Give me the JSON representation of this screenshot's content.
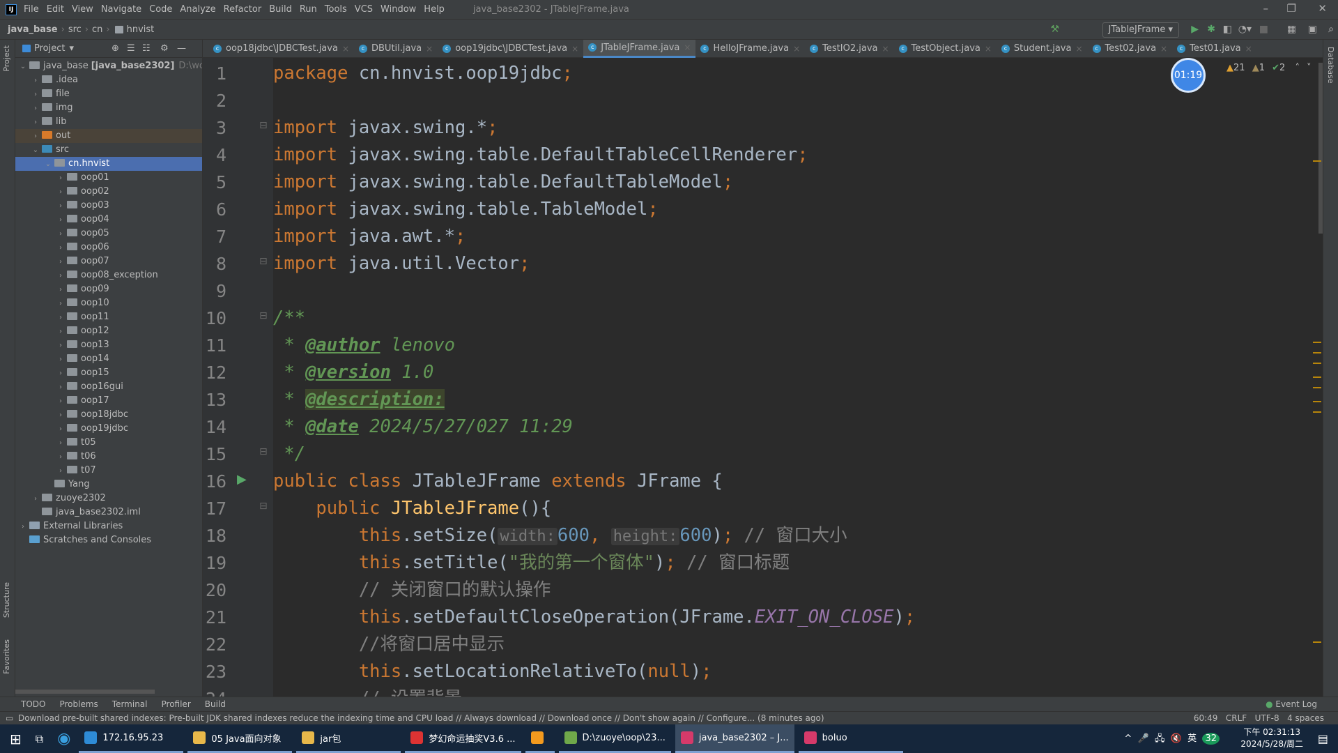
{
  "menubar": {
    "items": [
      "File",
      "Edit",
      "View",
      "Navigate",
      "Code",
      "Analyze",
      "Refactor",
      "Build",
      "Run",
      "Tools",
      "VCS",
      "Window",
      "Help"
    ],
    "window_title": "java_base2302 - JTableJFrame.java"
  },
  "breadcrumb": [
    "java_base",
    "src",
    "cn",
    "hnvist"
  ],
  "toolbar": {
    "run_config": "JTableJFrame"
  },
  "project": {
    "title": "Project",
    "tree": [
      {
        "d": 0,
        "label": "java_base",
        "bold": "[java_base2302]",
        "path": "D:\\work\\gg",
        "exp": true,
        "t": "mod"
      },
      {
        "d": 1,
        "label": ".idea",
        "t": "dir"
      },
      {
        "d": 1,
        "label": "file",
        "t": "dir"
      },
      {
        "d": 1,
        "label": "img",
        "t": "dir"
      },
      {
        "d": 1,
        "label": "lib",
        "t": "dir"
      },
      {
        "d": 1,
        "label": "out",
        "t": "out"
      },
      {
        "d": 1,
        "label": "src",
        "t": "src",
        "exp": true
      },
      {
        "d": 2,
        "label": "cn.hnvist",
        "t": "pkg",
        "exp": true,
        "sel": true
      },
      {
        "d": 3,
        "label": "oop01",
        "t": "pkg"
      },
      {
        "d": 3,
        "label": "oop02",
        "t": "pkg"
      },
      {
        "d": 3,
        "label": "oop03",
        "t": "pkg"
      },
      {
        "d": 3,
        "label": "oop04",
        "t": "pkg"
      },
      {
        "d": 3,
        "label": "oop05",
        "t": "pkg"
      },
      {
        "d": 3,
        "label": "oop06",
        "t": "pkg"
      },
      {
        "d": 3,
        "label": "oop07",
        "t": "pkg"
      },
      {
        "d": 3,
        "label": "oop08_exception",
        "t": "pkg"
      },
      {
        "d": 3,
        "label": "oop09",
        "t": "pkg"
      },
      {
        "d": 3,
        "label": "oop10",
        "t": "pkg"
      },
      {
        "d": 3,
        "label": "oop11",
        "t": "pkg"
      },
      {
        "d": 3,
        "label": "oop12",
        "t": "pkg"
      },
      {
        "d": 3,
        "label": "oop13",
        "t": "pkg"
      },
      {
        "d": 3,
        "label": "oop14",
        "t": "pkg"
      },
      {
        "d": 3,
        "label": "oop15",
        "t": "pkg"
      },
      {
        "d": 3,
        "label": "oop16gui",
        "t": "pkg"
      },
      {
        "d": 3,
        "label": "oop17",
        "t": "pkg"
      },
      {
        "d": 3,
        "label": "oop18jdbc",
        "t": "pkg"
      },
      {
        "d": 3,
        "label": "oop19jdbc",
        "t": "pkg"
      },
      {
        "d": 3,
        "label": "t05",
        "t": "pkg"
      },
      {
        "d": 3,
        "label": "t06",
        "t": "pkg"
      },
      {
        "d": 3,
        "label": "t07",
        "t": "pkg"
      },
      {
        "d": 2,
        "label": "Yang",
        "t": "pkg",
        "leaf": true
      },
      {
        "d": 1,
        "label": "zuoye2302",
        "t": "pkg"
      },
      {
        "d": 1,
        "label": "java_base2302.iml",
        "t": "file",
        "leaf": true
      },
      {
        "d": 0,
        "label": "External Libraries",
        "t": "lib"
      },
      {
        "d": 0,
        "label": "Scratches and Consoles",
        "t": "scratch",
        "leaf": true
      }
    ]
  },
  "tabs": [
    {
      "label": "oop18jdbc\\JDBCTest.java"
    },
    {
      "label": "DBUtil.java"
    },
    {
      "label": "oop19jdbc\\JDBCTest.java"
    },
    {
      "label": "JTableJFrame.java",
      "active": true
    },
    {
      "label": "HelloJFrame.java"
    },
    {
      "label": "TestIO2.java"
    },
    {
      "label": "TestObject.java"
    },
    {
      "label": "Student.java"
    },
    {
      "label": "Test02.java"
    },
    {
      "label": "Test01.java"
    }
  ],
  "timer": "01:19",
  "inspections": {
    "warnings": "21",
    "weak_warnings": "1",
    "ok": "2"
  },
  "code": [
    [
      [
        "k",
        "package "
      ],
      [
        "",
        "cn.hnvist.oop19jdbc"
      ],
      [
        "k",
        ";"
      ]
    ],
    [],
    [
      [
        "k",
        "import "
      ],
      [
        "",
        "javax.swing.*"
      ],
      [
        "k",
        ";"
      ]
    ],
    [
      [
        "k",
        "import "
      ],
      [
        "",
        "javax.swing.table.DefaultTableCellRenderer"
      ],
      [
        "k",
        ";"
      ]
    ],
    [
      [
        "k",
        "import "
      ],
      [
        "",
        "javax.swing.table.DefaultTableModel"
      ],
      [
        "k",
        ";"
      ]
    ],
    [
      [
        "k",
        "import "
      ],
      [
        "",
        "javax.swing.table.TableModel"
      ],
      [
        "k",
        ";"
      ]
    ],
    [
      [
        "k",
        "import "
      ],
      [
        "",
        "java.awt.*"
      ],
      [
        "k",
        ";"
      ]
    ],
    [
      [
        "k",
        "import "
      ],
      [
        "",
        "java.util.Vector"
      ],
      [
        "k",
        ";"
      ]
    ],
    [],
    [
      [
        "j",
        "/**"
      ]
    ],
    [
      [
        "j",
        " * "
      ],
      [
        "jt",
        "@author"
      ],
      [
        "j",
        " lenovo"
      ]
    ],
    [
      [
        "j",
        " * "
      ],
      [
        "jt",
        "@version"
      ],
      [
        "j",
        " 1.0"
      ]
    ],
    [
      [
        "j",
        " * "
      ],
      [
        "jt jh",
        "@description:"
      ]
    ],
    [
      [
        "j",
        " * "
      ],
      [
        "jt",
        "@date"
      ],
      [
        "j",
        " 2024/5/27/027 11:29"
      ]
    ],
    [
      [
        "j",
        " */"
      ]
    ],
    [
      [
        "k",
        "public class "
      ],
      [
        "",
        "JTableJFrame "
      ],
      [
        "k",
        "extends "
      ],
      [
        "",
        "JFrame {"
      ]
    ],
    [
      [
        "",
        "    "
      ],
      [
        "k",
        "public "
      ],
      [
        "m",
        "JTableJFrame"
      ],
      [
        "",
        "(){"
      ]
    ],
    [
      [
        "",
        "        "
      ],
      [
        "k",
        "this"
      ],
      [
        "",
        ".setSize("
      ],
      [
        "h",
        "width:"
      ],
      [
        "n",
        "600"
      ],
      [
        "k",
        ", "
      ],
      [
        "h",
        "height:"
      ],
      [
        "n",
        "600"
      ],
      [
        "",
        ")"
      ],
      [
        "k",
        ";"
      ],
      [
        "c",
        " // 窗口大小"
      ]
    ],
    [
      [
        "",
        "        "
      ],
      [
        "k",
        "this"
      ],
      [
        "",
        ".setTitle("
      ],
      [
        "s",
        "\"我的第一个窗体\""
      ],
      [
        "",
        ")"
      ],
      [
        "k",
        ";"
      ],
      [
        "c",
        " // 窗口标题"
      ]
    ],
    [
      [
        "c",
        "        // 关闭窗口的默认操作"
      ]
    ],
    [
      [
        "",
        "        "
      ],
      [
        "k",
        "this"
      ],
      [
        "",
        ".setDefaultCloseOperation(JFrame."
      ],
      [
        "f",
        "EXIT_ON_CLOSE"
      ],
      [
        "",
        ")"
      ],
      [
        "k",
        ";"
      ]
    ],
    [
      [
        "c",
        "        //将窗口居中显示"
      ]
    ],
    [
      [
        "",
        "        "
      ],
      [
        "k",
        "this"
      ],
      [
        "",
        ".setLocationRelativeTo("
      ],
      [
        "k",
        "null"
      ],
      [
        "",
        ")"
      ],
      [
        "k",
        ";"
      ]
    ],
    [
      [
        "c",
        "        // 设置背景"
      ]
    ]
  ],
  "toolwindows": [
    "TODO",
    "Problems",
    "Terminal",
    "Profiler",
    "Build"
  ],
  "event_log": "Event Log",
  "status": {
    "message": "Download pre-built shared indexes: Pre-built JDK shared indexes reduce the indexing time and CPU load // Always download // Download once // Don't show again // Configure... (8 minutes ago)",
    "position": "60:49",
    "line_sep": "CRLF",
    "encoding": "UTF-8",
    "indent": "4 spaces"
  },
  "side_labels": {
    "project": "Project",
    "structure": "Structure",
    "favorites": "Favorites",
    "database": "Database"
  },
  "taskbar": {
    "items": [
      {
        "label": "172.16.95.23",
        "color": "#2e8bd6"
      },
      {
        "label": "05 Java面向对象",
        "color": "#e8b84a"
      },
      {
        "label": "jar包",
        "color": "#e8b84a"
      },
      {
        "label": "梦幻命运抽奖V3.6 ...",
        "color": "#d33"
      },
      {
        "label": "",
        "color": "#f39a1e"
      },
      {
        "label": "D:\\zuoye\\oop\\23...",
        "color": "#6fa84a"
      },
      {
        "label": "java_base2302 – J...",
        "color": "#d63a6a",
        "active": true
      },
      {
        "label": "boluo",
        "color": "#d63a6a"
      }
    ],
    "tray": {
      "ime": "英",
      "badge": "32"
    },
    "time": "下午 02:31:13",
    "date": "2024/5/28/周二"
  }
}
